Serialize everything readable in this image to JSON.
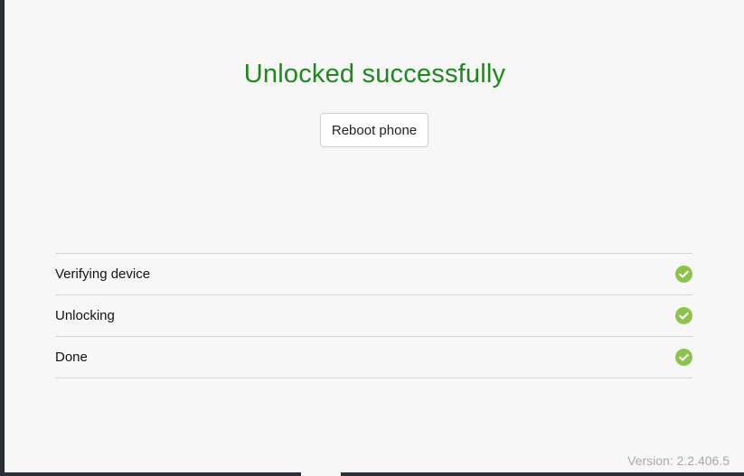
{
  "result": {
    "title": "Unlocked successfully",
    "reboot_label": "Reboot phone"
  },
  "steps": [
    {
      "label": "Verifying device",
      "icon": "check-circle-icon",
      "status": "done"
    },
    {
      "label": "Unlocking",
      "icon": "check-circle-icon",
      "status": "done"
    },
    {
      "label": "Done",
      "icon": "check-circle-icon",
      "status": "done"
    }
  ],
  "footer": {
    "version": "Version: 2.2.406.5"
  },
  "colors": {
    "title": "#1b8a1b",
    "check": "#8ac44a",
    "background": "#f7f7f7"
  }
}
